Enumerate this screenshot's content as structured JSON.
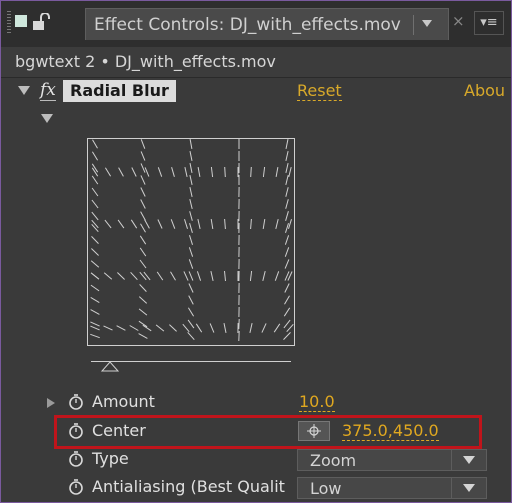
{
  "panel": {
    "tab_title": "Effect Controls: DJ_with_effects.mov",
    "close_glyph": "×",
    "menu_glyph": "▾≡",
    "layer_label": "bgwtext 2 • DJ_with_effects.mov"
  },
  "effect": {
    "fx_glyph": "fx",
    "name": "Radial Blur",
    "reset_label": "Reset",
    "about_label": "Abou"
  },
  "properties": {
    "amount": {
      "label": "Amount",
      "value": "10.0"
    },
    "center": {
      "label": "Center",
      "value": "375.0,450.0"
    },
    "type": {
      "label": "Type",
      "value": "Zoom"
    },
    "antialiasing": {
      "label": "Antialiasing (Best Qualit",
      "value": "Low"
    }
  },
  "colors": {
    "accent": "#d8a92a",
    "highlight_box": "#c0141b",
    "panel_border": "#7a5a9e"
  }
}
